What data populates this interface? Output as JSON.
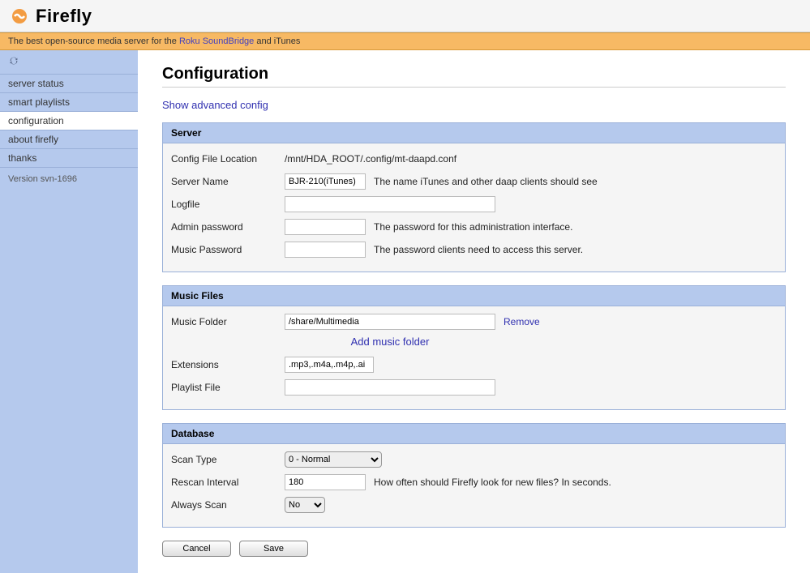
{
  "header": {
    "logo_text": "Firefly",
    "tagline_pre": "The best open-source media server for the ",
    "tagline_link": "Roku SoundBridge",
    "tagline_post": " and iTunes"
  },
  "sidebar": {
    "items": [
      {
        "label": "server status"
      },
      {
        "label": "smart playlists"
      },
      {
        "label": "configuration"
      },
      {
        "label": "about firefly"
      },
      {
        "label": "thanks"
      }
    ],
    "version": "Version svn-1696"
  },
  "page": {
    "title": "Configuration",
    "adv_link": "Show advanced config"
  },
  "server": {
    "heading": "Server",
    "config_file_label": "Config File Location",
    "config_file_value": "/mnt/HDA_ROOT/.config/mt-daapd.conf",
    "server_name_label": "Server Name",
    "server_name_value": "BJR-210(iTunes)",
    "server_name_desc": "The name iTunes and other daap clients should see",
    "logfile_label": "Logfile",
    "logfile_value": "",
    "admin_pw_label": "Admin password",
    "admin_pw_value": "",
    "admin_pw_desc": "The password for this administration interface.",
    "music_pw_label": "Music Password",
    "music_pw_value": "",
    "music_pw_desc": "The password clients need to access this server."
  },
  "music": {
    "heading": "Music Files",
    "folder_label": "Music Folder",
    "folder_value": "/share/Multimedia",
    "remove_link": "Remove",
    "add_link": "Add music folder",
    "ext_label": "Extensions",
    "ext_value": ".mp3,.m4a,.m4p,.ai",
    "playlist_label": "Playlist File",
    "playlist_value": ""
  },
  "database": {
    "heading": "Database",
    "scan_type_label": "Scan Type",
    "scan_type_value": "0 - Normal",
    "rescan_label": "Rescan Interval",
    "rescan_value": "180",
    "rescan_desc": "How often should Firefly look for new files? In seconds.",
    "always_scan_label": "Always Scan",
    "always_scan_value": "No"
  },
  "buttons": {
    "cancel": "Cancel",
    "save": "Save"
  }
}
